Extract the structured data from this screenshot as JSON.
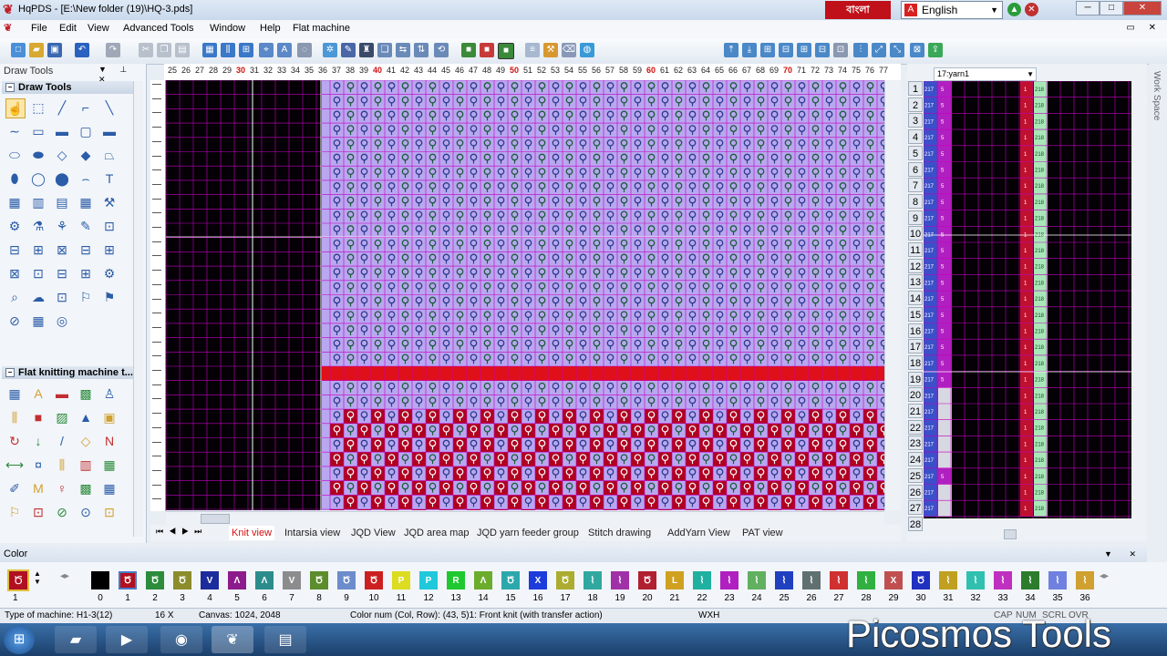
{
  "window": {
    "title": "HqPDS - [E:\\New folder (19)\\HQ-3.pds]",
    "language_badge": "বাংলা",
    "language": "English",
    "min": "─",
    "max": "□",
    "close": "✕"
  },
  "menu": [
    "File",
    "Edit",
    "View",
    "Advanced Tools",
    "Window",
    "Help",
    "Flat machine"
  ],
  "left_panel": {
    "title": "Draw Tools",
    "section1": "Draw Tools",
    "section2": "Flat knitting machine t..."
  },
  "ruler": {
    "ticks": [
      "25",
      "26",
      "27",
      "28",
      "29",
      "30",
      "31",
      "32",
      "33",
      "34",
      "35",
      "36",
      "37",
      "38",
      "39",
      "40",
      "41",
      "42",
      "43",
      "44",
      "45",
      "46",
      "47",
      "48",
      "49",
      "50",
      "51",
      "52",
      "53",
      "54",
      "55",
      "56",
      "57",
      "58",
      "59",
      "60",
      "61",
      "62",
      "63",
      "64",
      "65",
      "66",
      "67",
      "68",
      "69",
      "70",
      "71",
      "72",
      "73",
      "74",
      "75",
      "76",
      "77"
    ],
    "highlight": [
      "30",
      "40",
      "50",
      "60",
      "70"
    ]
  },
  "tabs": [
    "Knit view",
    "Intarsia view",
    "JQD View",
    "JQD area map",
    "JQD yarn feeder group",
    "Stitch drawing",
    "AddYarn View",
    "PAT view"
  ],
  "active_tab": "Knit view",
  "right_panel": {
    "yarn_select": "17:yarn1",
    "row_numbers": [
      "1",
      "2",
      "3",
      "4",
      "5",
      "6",
      "7",
      "8",
      "9",
      "10",
      "11",
      "12",
      "13",
      "14",
      "15",
      "16",
      "17",
      "18",
      "19",
      "20",
      "21",
      "22",
      "23",
      "24",
      "25",
      "26",
      "27",
      "28"
    ],
    "col_a": "217",
    "col_b": "5",
    "col_c": "1",
    "col_d": "218"
  },
  "work_space": "Work Space",
  "color_panel": {
    "title": "Color",
    "selected": "1",
    "items": [
      {
        "n": "0",
        "c": "#000000",
        "g": ""
      },
      {
        "n": "1",
        "c": "#b01020",
        "g": "Ծ"
      },
      {
        "n": "2",
        "c": "#2c8c3c",
        "g": "Ծ"
      },
      {
        "n": "3",
        "c": "#8c8c2c",
        "g": "Ծ"
      },
      {
        "n": "4",
        "c": "#1c2c9c",
        "g": "V"
      },
      {
        "n": "5",
        "c": "#8c1c8c",
        "g": "Λ"
      },
      {
        "n": "6",
        "c": "#2c8c8c",
        "g": "Λ"
      },
      {
        "n": "7",
        "c": "#8c8c8c",
        "g": "V"
      },
      {
        "n": "8",
        "c": "#5c8c2c",
        "g": "Ծ"
      },
      {
        "n": "9",
        "c": "#6c8ccc",
        "g": "Ծ"
      },
      {
        "n": "10",
        "c": "#cc2020",
        "g": "Ծ"
      },
      {
        "n": "11",
        "c": "#dcdc20",
        "g": "P"
      },
      {
        "n": "12",
        "c": "#20c8dc",
        "g": "P"
      },
      {
        "n": "13",
        "c": "#20c830",
        "g": "R"
      },
      {
        "n": "14",
        "c": "#6cac2c",
        "g": "Λ"
      },
      {
        "n": "15",
        "c": "#2ca8ac",
        "g": "Ծ"
      },
      {
        "n": "16",
        "c": "#1c3cdc",
        "g": "X"
      },
      {
        "n": "17",
        "c": "#acac30",
        "g": "Ծ"
      },
      {
        "n": "18",
        "c": "#30a8a0",
        "g": "⌇"
      },
      {
        "n": "19",
        "c": "#a030a8",
        "g": "⌇"
      },
      {
        "n": "20",
        "c": "#b02030",
        "g": "Ծ"
      },
      {
        "n": "21",
        "c": "#d0a020",
        "g": "L"
      },
      {
        "n": "22",
        "c": "#20b0a0",
        "g": "⌇"
      },
      {
        "n": "23",
        "c": "#b020c0",
        "g": "⌇"
      },
      {
        "n": "24",
        "c": "#60b060",
        "g": "⌇"
      },
      {
        "n": "25",
        "c": "#2040c0",
        "g": "⌇"
      },
      {
        "n": "26",
        "c": "#607070",
        "g": "⌇"
      },
      {
        "n": "27",
        "c": "#d03030",
        "g": "⌇"
      },
      {
        "n": "28",
        "c": "#30b040",
        "g": "⌇"
      },
      {
        "n": "29",
        "c": "#c05050",
        "g": "X"
      },
      {
        "n": "30",
        "c": "#2030c0",
        "g": "Ծ"
      },
      {
        "n": "31",
        "c": "#c0a020",
        "g": "⌇"
      },
      {
        "n": "32",
        "c": "#30c0b0",
        "g": "⌇"
      },
      {
        "n": "33",
        "c": "#c030c0",
        "g": "⌇"
      },
      {
        "n": "34",
        "c": "#2c7c2c",
        "g": "⌇"
      },
      {
        "n": "35",
        "c": "#7080e0",
        "g": "⌇"
      },
      {
        "n": "36",
        "c": "#d0a030",
        "g": "⌇"
      }
    ]
  },
  "status": {
    "machine": "Type of machine: H1-3(12)",
    "zoom": "16 X",
    "canvas": "Canvas: 1024, 2048",
    "color_info": "Color num  (Col, Row): (43, 5)1: Front knit (with transfer action)",
    "wxh": "WXH",
    "cap": "CAP",
    "num": "NUM",
    "scrl": "SCRL",
    "ovr": "OVR"
  },
  "watermark": "Picosmos Tools",
  "colors": {
    "grid_bg": "#050005",
    "grid_line": "#c000c0",
    "purple_cell": "#b9a7f0",
    "red_stripe": "#e0101a",
    "dark_red": "#b00020"
  }
}
